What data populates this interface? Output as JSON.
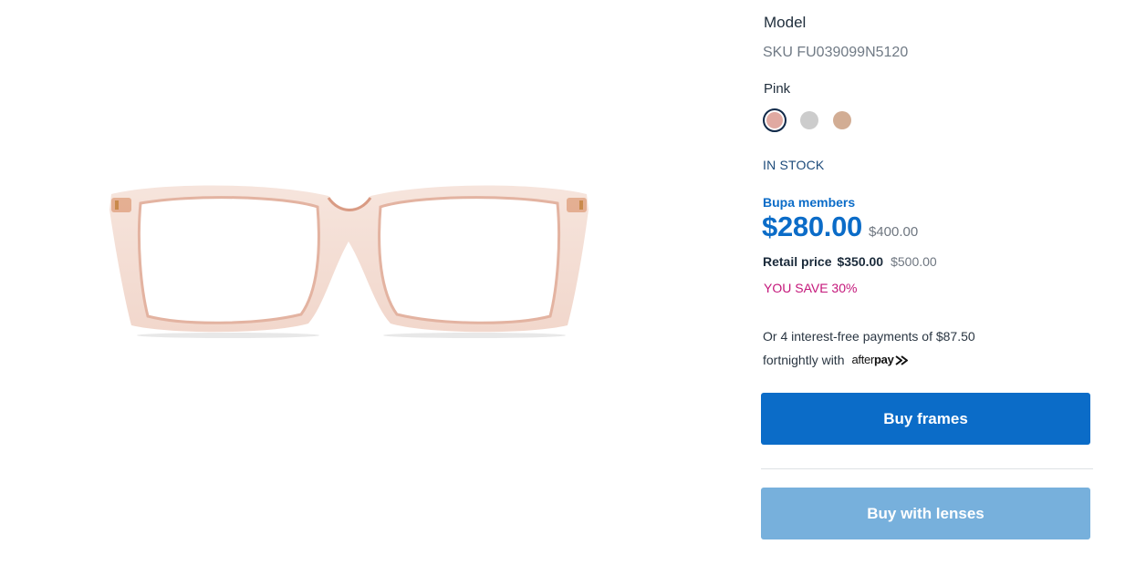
{
  "product": {
    "model_label": "Model",
    "sku": "SKU FU039099N5120",
    "image_icon": "eyeglasses-frame-image"
  },
  "colors": {
    "selected_name": "Pink",
    "swatches": [
      {
        "name": "Pink",
        "color": "#e0a9a1",
        "selected": true
      },
      {
        "name": "Grey",
        "color": "#cccccc",
        "selected": false
      },
      {
        "name": "Tan",
        "color": "#d2ad94",
        "selected": false
      }
    ]
  },
  "availability": "IN STOCK",
  "pricing": {
    "members_label": "Bupa members",
    "member_price": "$280.00",
    "member_was": "$400.00",
    "retail_label": "Retail price",
    "retail_price": "$350.00",
    "retail_was": "$500.00",
    "savings": "YOU SAVE 30%",
    "accent_color": "#0b6cc8",
    "savings_color": "#c4167a"
  },
  "afterpay": {
    "line1": "Or 4 interest-free payments of $87.50",
    "line2": "fortnightly with",
    "logo_text_a": "after",
    "logo_text_b": "pay",
    "logo_icon": "afterpay-arrows-icon"
  },
  "actions": {
    "buy_frames": "Buy frames",
    "buy_with_lenses": "Buy with lenses"
  }
}
